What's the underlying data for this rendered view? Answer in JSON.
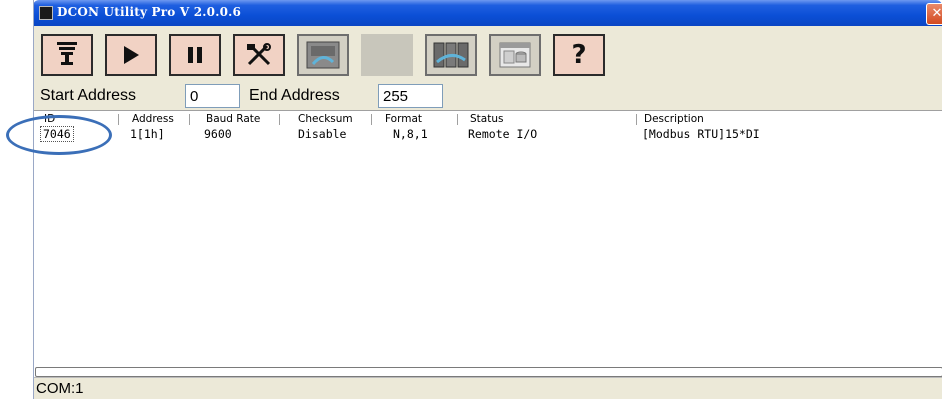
{
  "window": {
    "title": "DCON Utility Pro V 2.0.0.6",
    "close_label": "✕"
  },
  "toolbar": {
    "buttons": [
      {
        "name": "search-com-port",
        "icon": "plug-icon"
      },
      {
        "name": "start-search",
        "icon": "play-icon"
      },
      {
        "name": "stop-search",
        "icon": "pause-icon"
      },
      {
        "name": "tools",
        "icon": "tools-icon"
      },
      {
        "name": "module-config",
        "icon": "module-icon"
      },
      {
        "name": "blank",
        "icon": ""
      },
      {
        "name": "module-terminal",
        "icon": "terminal-icon"
      },
      {
        "name": "database",
        "icon": "window-db-icon"
      },
      {
        "name": "help",
        "icon": "question-icon",
        "label": "?"
      }
    ]
  },
  "address": {
    "start_label": "Start Address",
    "start_value": "0",
    "end_label": "End Address",
    "end_value": "255"
  },
  "table": {
    "columns": [
      "ID",
      "Address",
      "Baud Rate",
      "Checksum",
      "Format",
      "Status",
      "Description"
    ],
    "rows": [
      {
        "id": "7046",
        "address": "1[1h]",
        "baud": "9600",
        "checksum": "Disable",
        "format": "N,8,1",
        "status": "Remote I/O",
        "description": "[Modbus RTU]15*DI"
      }
    ]
  },
  "statusbar": {
    "text": "COM:1"
  },
  "colors": {
    "titlebar": "#0b4fd6",
    "button_bg": "#f1d2c4",
    "annotation": "#3b6fb8"
  }
}
